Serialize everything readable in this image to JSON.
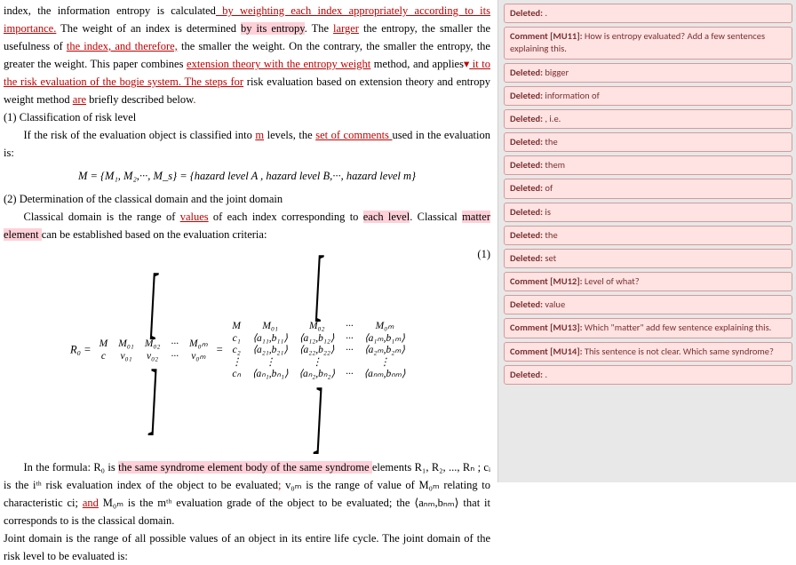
{
  "doc": {
    "p1a": "index, the information entropy is calculated",
    "p1_ins1": " by weighting each index appropriately according to its importance.",
    "p1b": " The weight of an index is determined ",
    "p1_hl1": "by its entropy",
    "p1c": ". The ",
    "p1_ins2": "larger",
    "p1d": " the entropy, the smaller the usefulness of ",
    "p1_ins2b": "the index, and therefore,",
    "p1e": " the smaller the weight. On the contrary, the smaller the entropy, the greater the weight. This paper combines ",
    "p1_ins3": "extension theory with the entropy weight",
    "p1f": " method, and applies",
    "p1_ins3b": " it to the risk evaluation of the bogie system. The steps ",
    "p1_ins4": "for",
    "p1g": " risk evaluation based on extension theory and entropy weight method ",
    "p1_ins5": "are",
    "p1h": " briefly described below",
    "p1_ins6": ".",
    "h1": "(1) Classification of risk level",
    "p2a": "If the risk of the evaluation object is classified into ",
    "p2_ins1": "m",
    "p2b": " levels, the ",
    "p2_ins2": "set of comments ",
    "p2c": "used in the evaluation is:",
    "eq1": "M = {M₁,   M₂,···,   M_s} = {hazard level A ,   hazard level B,···,   hazard level m}",
    "h2": "(2) Determination of the classical domain and the joint domain",
    "p3a": "Classical domain is the range of ",
    "p3_ins1": "values",
    "p3b": " of each index corresponding to ",
    "p3_hl1": "each level",
    "p3c": ". Classical ",
    "p3_hl2": "matter element ",
    "p3d": "can be established based on the evaluation criteria:",
    "matrix_left_rows": [
      [
        "M",
        "M₀₁",
        "M₀₂",
        "···",
        "M₀ₘ"
      ],
      [
        "c",
        "v₀₁",
        "v₀₂",
        "···",
        "v₀ₘ"
      ]
    ],
    "matrix_right_rows": [
      [
        "M",
        "M₀₁",
        "M₀₂",
        "···",
        "M₀ₘ"
      ],
      [
        "c₁",
        "⟨a₁₁,b₁₁⟩",
        "⟨a₁₂,b₁₂⟩",
        "···",
        "⟨a₁ₘ,b₁ₘ⟩"
      ],
      [
        "c₂",
        "⟨a₂₁,b₂₁⟩",
        "⟨a₂₂,b₂₂⟩",
        "···",
        "⟨a₂ₘ,b₂ₘ⟩"
      ],
      [
        "⋮",
        "⋮",
        "⋮",
        " ",
        "⋮"
      ],
      [
        "cₙ",
        "⟨aₙ₁,bₙ₁⟩",
        "⟨aₙ₂,bₙ₂⟩",
        "···",
        "⟨aₙₘ,bₙₘ⟩"
      ]
    ],
    "eq2_lhs": "R₀ =",
    "eq2_num": "(1)",
    "p4a": "In the formula:  R₀ is ",
    "p4_hl1": "the same syndrome element body of the same syndrome ",
    "p4b": "elements R₁, R₂, ..., Rₙ ;  cᵢ is the iᵗʰ risk evaluation index of the object to be evaluated",
    "p4_ins1": ";",
    "p4c": "   v₀ₘ   is the range of value of  M₀ₘ   relating to characteristic ci; ",
    "p4_ins2": "and",
    "p4d": "  M₀ₘ is the mᵗʰ evaluation grade of the object to be evaluated; the  ⟨aₙₘ,bₙₘ⟩  that it corresponds to is the classical domain.",
    "p5": "Joint domain is the range of all possible values of an object in its entire life cycle.  The joint domain of the risk level to be evaluated is:"
  },
  "balloons": [
    {
      "label": "Deleted:",
      "text": " ."
    },
    {
      "label": "Comment [MU11]:",
      "text": " How is entropy evaluated? Add a few sentences explaining this."
    },
    {
      "label": "Deleted:",
      "text": " bigger"
    },
    {
      "label": "Deleted:",
      "text": " information of"
    },
    {
      "label": "Deleted:",
      "text": " , i.e."
    },
    {
      "label": "Deleted:",
      "text": " the"
    },
    {
      "label": "Deleted:",
      "text": " them"
    },
    {
      "label": "Deleted:",
      "text": " of"
    },
    {
      "label": "Deleted:",
      "text": " is"
    },
    {
      "label": "Deleted:",
      "text": " the"
    },
    {
      "label": "Deleted:",
      "text": " set"
    },
    {
      "label": "Comment [MU12]:",
      "text": " Level of what?"
    },
    {
      "label": "Deleted:",
      "text": " value"
    },
    {
      "label": "Comment [MU13]:",
      "text": " Which \"matter\" add few sentence explaining this."
    },
    {
      "label": "Comment [MU14]:",
      "text": " This sentence is not clear. Which same syndrome?"
    },
    {
      "label": "Deleted:",
      "text": " ."
    }
  ]
}
